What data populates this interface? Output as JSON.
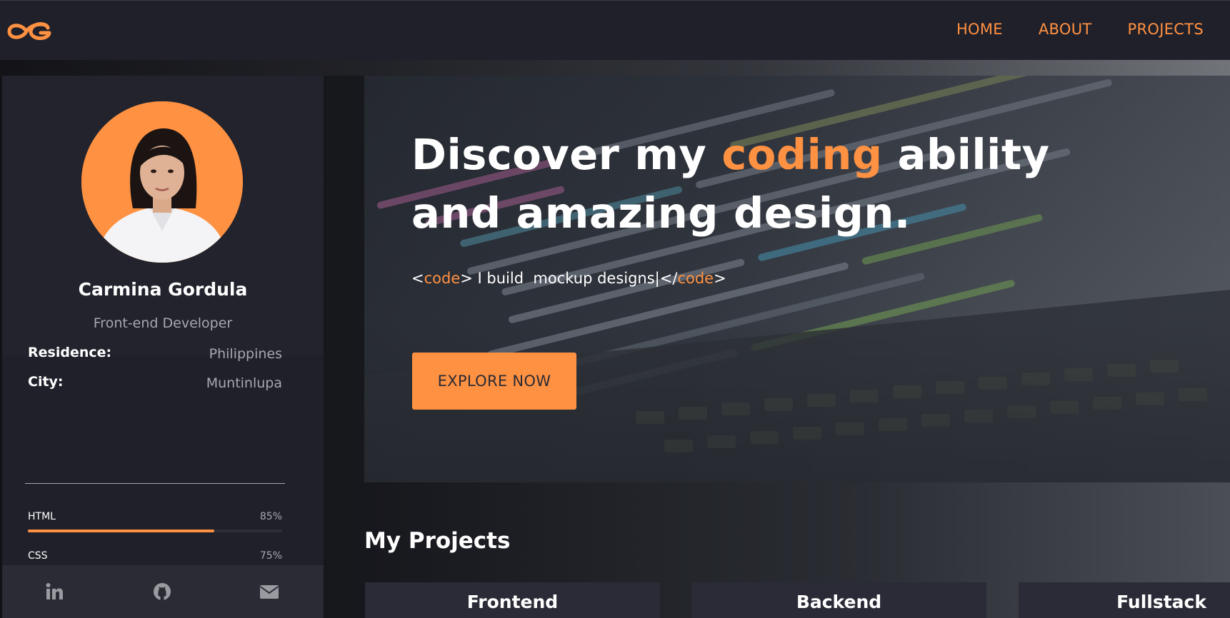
{
  "brand": {
    "logo_text": "CG",
    "accent": "#ff9142"
  },
  "nav": {
    "items": [
      {
        "label": "HOME"
      },
      {
        "label": "ABOUT"
      },
      {
        "label": "PROJECTS"
      }
    ]
  },
  "profile": {
    "name": "Carmina Gordula",
    "role": "Front-end Developer",
    "info": [
      {
        "label": "Residence:",
        "value": "Philippines"
      },
      {
        "label": "City:",
        "value": "Muntinlupa"
      }
    ],
    "skills": [
      {
        "name": "HTML",
        "percent_label": "85%",
        "level": 0.85
      },
      {
        "name": "CSS",
        "percent_label": "75%",
        "level": 0.75
      }
    ],
    "social": [
      {
        "icon": "linkedin-icon"
      },
      {
        "icon": "github-icon"
      },
      {
        "icon": "envelope-icon"
      }
    ]
  },
  "hero": {
    "title_part1": "Discover my ",
    "title_accent": "coding",
    "title_part2": " ability",
    "title_line2": "and amazing design.",
    "sub_open_bracket": "<",
    "sub_open_tag": "code",
    "sub_mid": "> I build  mockup designs|</",
    "sub_close_tag": "code",
    "sub_close_bracket": ">",
    "cta_label": "EXPLORE NOW"
  },
  "projects": {
    "title": "My Projects",
    "cards": [
      {
        "label": "Frontend"
      },
      {
        "label": "Backend"
      },
      {
        "label": "Fullstack"
      }
    ]
  }
}
